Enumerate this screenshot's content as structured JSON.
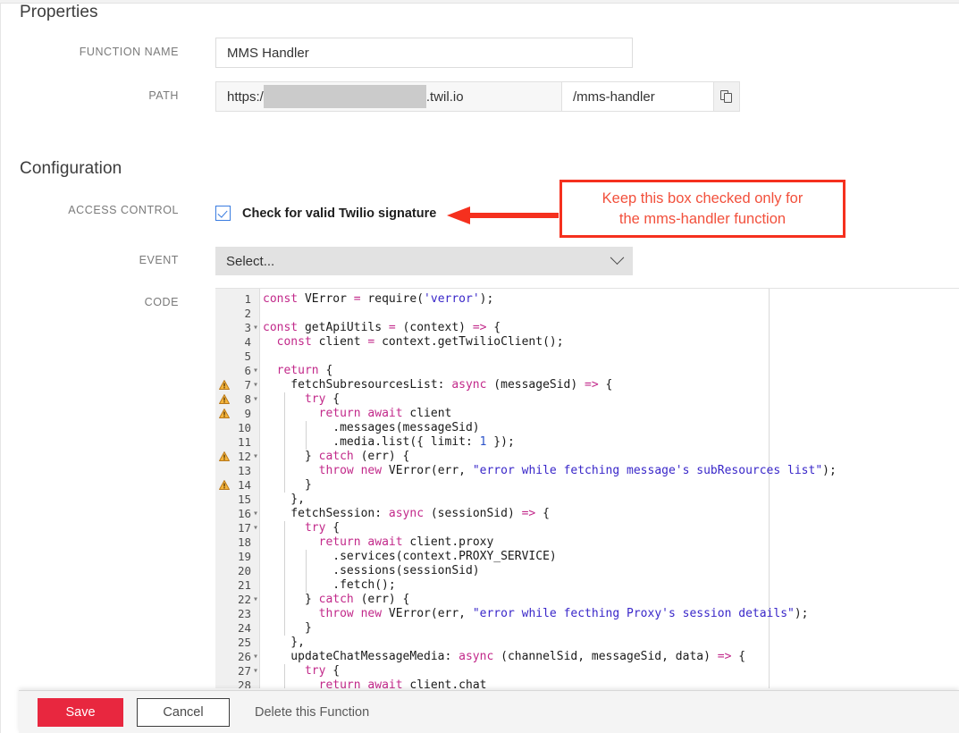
{
  "sections": {
    "properties_title": "Properties",
    "configuration_title": "Configuration"
  },
  "labels": {
    "function_name": "FUNCTION NAME",
    "path": "PATH",
    "access_control": "ACCESS CONTROL",
    "event": "EVENT",
    "code": "CODE"
  },
  "function_name": {
    "value": "MMS Handler",
    "placeholder": ""
  },
  "path": {
    "prefix": "https:/",
    "masked": "",
    "domain": ".twil.io",
    "route": "/mms-handler",
    "copy_icon": "copy-icon"
  },
  "access_control": {
    "checkbox_label": "Check for valid Twilio signature",
    "checked": true,
    "check_color": "#3a7ce0"
  },
  "event": {
    "selected": "Select...",
    "chevron_icon": "chevron-down-icon"
  },
  "annotation": {
    "line1": "Keep this box checked only for",
    "line2": "the mms-handler function",
    "border_color": "#f5301e",
    "text_color": "#f2503c",
    "arrow_icon": "left-arrow-icon"
  },
  "footer": {
    "save_label": "Save",
    "cancel_label": "Cancel",
    "delete_label": "Delete this Function",
    "save_color": "#e8273f"
  },
  "code_editor": {
    "warning_icon": "warning-triangle-icon",
    "fold_icon": "fold-arrow-icon",
    "lines": [
      {
        "n": "1",
        "warn": false,
        "fold": false,
        "indent": 0,
        "tokens": [
          {
            "t": "const",
            "c": "kw"
          },
          {
            "t": " VError ",
            "c": "pun"
          },
          {
            "t": "=",
            "c": "kw"
          },
          {
            "t": " require(",
            "c": "pun"
          },
          {
            "t": "'verror'",
            "c": "str"
          },
          {
            "t": ");",
            "c": "pun"
          }
        ]
      },
      {
        "n": "2",
        "warn": false,
        "fold": false,
        "indent": 0,
        "tokens": []
      },
      {
        "n": "3",
        "warn": false,
        "fold": true,
        "indent": 0,
        "tokens": [
          {
            "t": "const",
            "c": "kw"
          },
          {
            "t": " getApiUtils ",
            "c": "pun"
          },
          {
            "t": "=",
            "c": "kw"
          },
          {
            "t": " (context) ",
            "c": "pun"
          },
          {
            "t": "=>",
            "c": "kw"
          },
          {
            "t": " {",
            "c": "pun"
          }
        ]
      },
      {
        "n": "4",
        "warn": false,
        "fold": false,
        "indent": 0,
        "tokens": [
          {
            "t": "  ",
            "c": "pun"
          },
          {
            "t": "const",
            "c": "kw"
          },
          {
            "t": " client ",
            "c": "pun"
          },
          {
            "t": "=",
            "c": "kw"
          },
          {
            "t": " context.getTwilioClient();",
            "c": "pun"
          }
        ]
      },
      {
        "n": "5",
        "warn": false,
        "fold": false,
        "indent": 0,
        "tokens": []
      },
      {
        "n": "6",
        "warn": false,
        "fold": true,
        "indent": 0,
        "tokens": [
          {
            "t": "  ",
            "c": "pun"
          },
          {
            "t": "return",
            "c": "kw"
          },
          {
            "t": " {",
            "c": "pun"
          }
        ]
      },
      {
        "n": "7",
        "warn": true,
        "fold": true,
        "indent": 0,
        "tokens": [
          {
            "t": "    fetchSubresourcesList: ",
            "c": "pun"
          },
          {
            "t": "async",
            "c": "kw"
          },
          {
            "t": " (messageSid) ",
            "c": "pun"
          },
          {
            "t": "=>",
            "c": "kw"
          },
          {
            "t": " {",
            "c": "pun"
          }
        ]
      },
      {
        "n": "8",
        "warn": true,
        "fold": true,
        "indent": 1,
        "tokens": [
          {
            "t": "      ",
            "c": "pun"
          },
          {
            "t": "try",
            "c": "kw"
          },
          {
            "t": " {",
            "c": "pun"
          }
        ]
      },
      {
        "n": "9",
        "warn": true,
        "fold": false,
        "indent": 1,
        "tokens": [
          {
            "t": "        ",
            "c": "pun"
          },
          {
            "t": "return",
            "c": "kw"
          },
          {
            "t": " ",
            "c": "pun"
          },
          {
            "t": "await",
            "c": "kw"
          },
          {
            "t": " client",
            "c": "pun"
          }
        ]
      },
      {
        "n": "10",
        "warn": false,
        "fold": false,
        "indent": 2,
        "tokens": [
          {
            "t": "          .messages(messageSid)",
            "c": "pun"
          }
        ]
      },
      {
        "n": "11",
        "warn": false,
        "fold": false,
        "indent": 2,
        "tokens": [
          {
            "t": "          .media.list({ limit: ",
            "c": "pun"
          },
          {
            "t": "1",
            "c": "num"
          },
          {
            "t": " });",
            "c": "pun"
          }
        ]
      },
      {
        "n": "12",
        "warn": true,
        "fold": true,
        "indent": 1,
        "tokens": [
          {
            "t": "      } ",
            "c": "pun"
          },
          {
            "t": "catch",
            "c": "kw"
          },
          {
            "t": " (err) {",
            "c": "pun"
          }
        ]
      },
      {
        "n": "13",
        "warn": false,
        "fold": false,
        "indent": 1,
        "tokens": [
          {
            "t": "        ",
            "c": "pun"
          },
          {
            "t": "throw",
            "c": "kw"
          },
          {
            "t": " ",
            "c": "pun"
          },
          {
            "t": "new",
            "c": "kw"
          },
          {
            "t": " VError(err, ",
            "c": "pun"
          },
          {
            "t": "\"error while fetching message's subResources list\"",
            "c": "str"
          },
          {
            "t": ");",
            "c": "pun"
          }
        ]
      },
      {
        "n": "14",
        "warn": true,
        "fold": false,
        "indent": 1,
        "tokens": [
          {
            "t": "      }",
            "c": "pun"
          }
        ]
      },
      {
        "n": "15",
        "warn": false,
        "fold": false,
        "indent": 0,
        "tokens": [
          {
            "t": "    },",
            "c": "pun"
          }
        ]
      },
      {
        "n": "16",
        "warn": false,
        "fold": true,
        "indent": 0,
        "tokens": [
          {
            "t": "    fetchSession: ",
            "c": "pun"
          },
          {
            "t": "async",
            "c": "kw"
          },
          {
            "t": " (sessionSid) ",
            "c": "pun"
          },
          {
            "t": "=>",
            "c": "kw"
          },
          {
            "t": " {",
            "c": "pun"
          }
        ]
      },
      {
        "n": "17",
        "warn": false,
        "fold": true,
        "indent": 1,
        "tokens": [
          {
            "t": "      ",
            "c": "pun"
          },
          {
            "t": "try",
            "c": "kw"
          },
          {
            "t": " {",
            "c": "pun"
          }
        ]
      },
      {
        "n": "18",
        "warn": false,
        "fold": false,
        "indent": 1,
        "tokens": [
          {
            "t": "        ",
            "c": "pun"
          },
          {
            "t": "return",
            "c": "kw"
          },
          {
            "t": " ",
            "c": "pun"
          },
          {
            "t": "await",
            "c": "kw"
          },
          {
            "t": " client.proxy",
            "c": "pun"
          }
        ]
      },
      {
        "n": "19",
        "warn": false,
        "fold": false,
        "indent": 2,
        "tokens": [
          {
            "t": "          .services(context.PROXY_SERVICE)",
            "c": "pun"
          }
        ]
      },
      {
        "n": "20",
        "warn": false,
        "fold": false,
        "indent": 2,
        "tokens": [
          {
            "t": "          .sessions(sessionSid)",
            "c": "pun"
          }
        ]
      },
      {
        "n": "21",
        "warn": false,
        "fold": false,
        "indent": 2,
        "tokens": [
          {
            "t": "          .fetch();",
            "c": "pun"
          }
        ]
      },
      {
        "n": "22",
        "warn": false,
        "fold": true,
        "indent": 1,
        "tokens": [
          {
            "t": "      } ",
            "c": "pun"
          },
          {
            "t": "catch",
            "c": "kw"
          },
          {
            "t": " (err) {",
            "c": "pun"
          }
        ]
      },
      {
        "n": "23",
        "warn": false,
        "fold": false,
        "indent": 1,
        "tokens": [
          {
            "t": "        ",
            "c": "pun"
          },
          {
            "t": "throw",
            "c": "kw"
          },
          {
            "t": " ",
            "c": "pun"
          },
          {
            "t": "new",
            "c": "kw"
          },
          {
            "t": " VError(err, ",
            "c": "pun"
          },
          {
            "t": "\"error while fecthing Proxy's session details\"",
            "c": "str"
          },
          {
            "t": ");",
            "c": "pun"
          }
        ]
      },
      {
        "n": "24",
        "warn": false,
        "fold": false,
        "indent": 1,
        "tokens": [
          {
            "t": "      }",
            "c": "pun"
          }
        ]
      },
      {
        "n": "25",
        "warn": false,
        "fold": false,
        "indent": 0,
        "tokens": [
          {
            "t": "    },",
            "c": "pun"
          }
        ]
      },
      {
        "n": "26",
        "warn": false,
        "fold": true,
        "indent": 0,
        "tokens": [
          {
            "t": "    updateChatMessageMedia: ",
            "c": "pun"
          },
          {
            "t": "async",
            "c": "kw"
          },
          {
            "t": " (channelSid, messageSid, data) ",
            "c": "pun"
          },
          {
            "t": "=>",
            "c": "kw"
          },
          {
            "t": " {",
            "c": "pun"
          }
        ]
      },
      {
        "n": "27",
        "warn": false,
        "fold": true,
        "indent": 1,
        "tokens": [
          {
            "t": "      ",
            "c": "pun"
          },
          {
            "t": "try",
            "c": "kw"
          },
          {
            "t": " {",
            "c": "pun"
          }
        ]
      },
      {
        "n": "28",
        "warn": false,
        "fold": false,
        "indent": 1,
        "tokens": [
          {
            "t": "        ",
            "c": "pun"
          },
          {
            "t": "return",
            "c": "kw"
          },
          {
            "t": " ",
            "c": "pun"
          },
          {
            "t": "await",
            "c": "kw"
          },
          {
            "t": " client.chat",
            "c": "pun"
          }
        ]
      }
    ]
  }
}
